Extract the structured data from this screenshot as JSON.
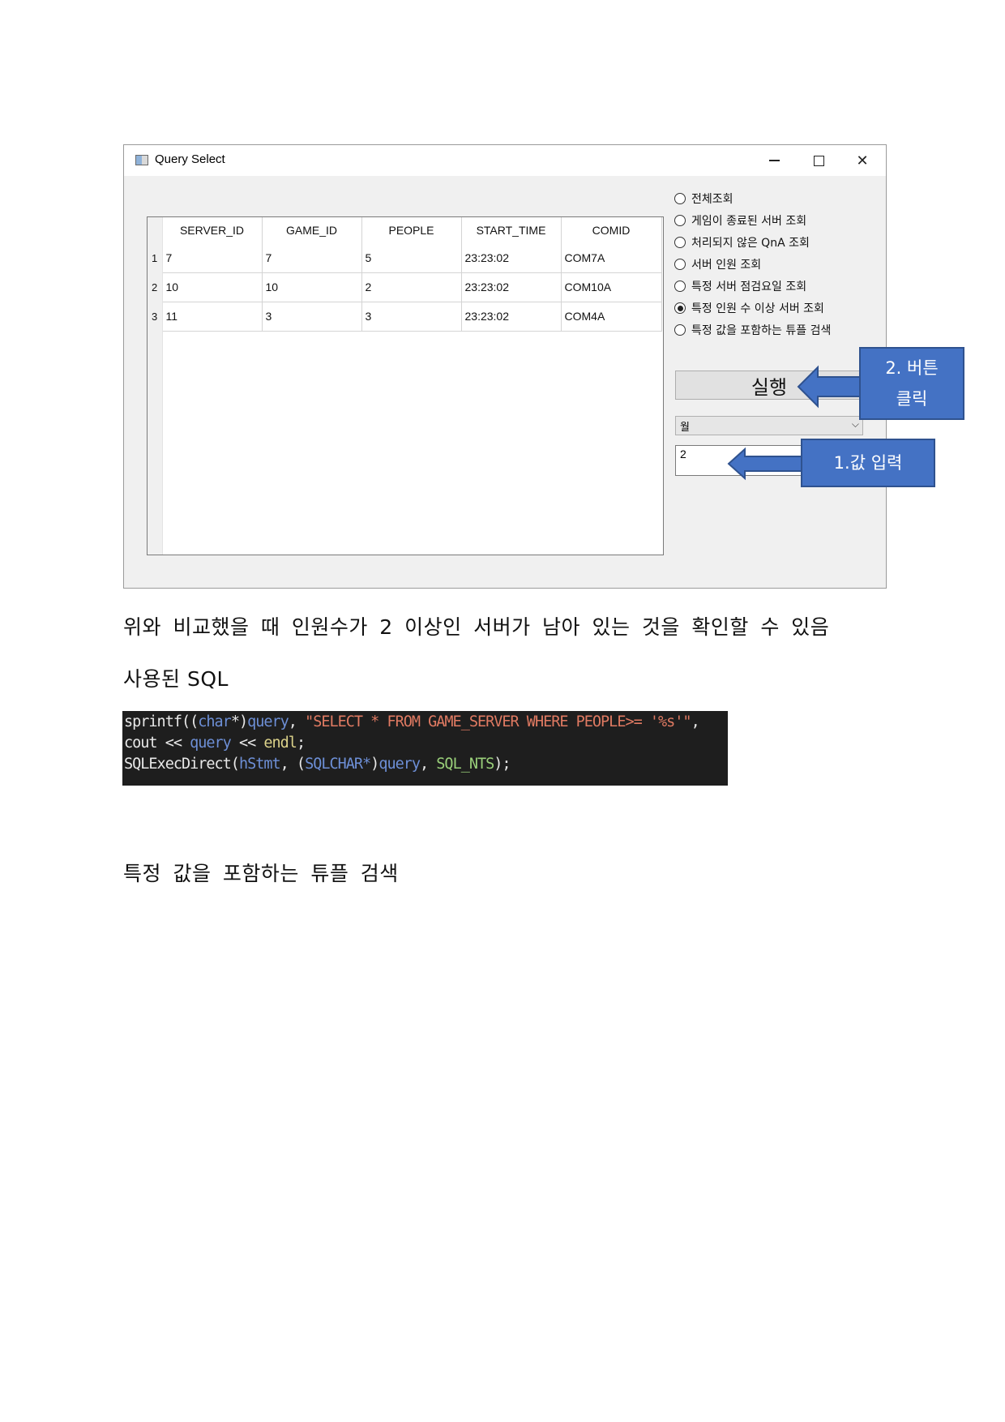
{
  "window": {
    "title": "Query Select",
    "controls": {
      "minimize": "—",
      "close": "✕"
    }
  },
  "table": {
    "columns": [
      "SERVER_ID",
      "GAME_ID",
      "PEOPLE",
      "START_TIME",
      "COMID"
    ],
    "rows": [
      {
        "num": "1",
        "cells": [
          "7",
          "7",
          "5",
          "23:23:02",
          "COM7A"
        ]
      },
      {
        "num": "2",
        "cells": [
          "10",
          "10",
          "2",
          "23:23:02",
          "COM10A"
        ]
      },
      {
        "num": "3",
        "cells": [
          "11",
          "3",
          "3",
          "23:23:02",
          "COM4A"
        ]
      }
    ]
  },
  "options": [
    {
      "label": "전체조회",
      "selected": false
    },
    {
      "label": "게임이 종료된 서버 조회",
      "selected": false
    },
    {
      "label": "처리되지 않은 QnA 조회",
      "selected": false
    },
    {
      "label": "서버 인원 조회",
      "selected": false
    },
    {
      "label": "특정 서버 점검요일 조회",
      "selected": false
    },
    {
      "label": "특정 인원 수 이상 서버 조회",
      "selected": true
    },
    {
      "label": "특정 값을 포함하는 튜플 검색",
      "selected": false
    }
  ],
  "run_button": "실행",
  "combo": {
    "value": "월",
    "arrow": "⌵"
  },
  "value_input": "2",
  "callouts": {
    "click_line1": "2. 버튼",
    "click_line2": "클릭",
    "input": "1.값 입력"
  },
  "colors": {
    "callout_fill": "#4472c4",
    "callout_border": "#2f528f",
    "code_bg": "#1e1e1e"
  },
  "text": {
    "compare": "위와 비교했을 때 인원수가 2 이상인 서버가 남아 있는 것을 확인할 수 있음",
    "sql_heading": "사용된 SQL",
    "next_heading": "특정 값을 포함하는 튜플 검색"
  },
  "code": {
    "l1_a": "sprintf((",
    "l1_b": "char",
    "l1_c": "*)",
    "l1_d": "query",
    "l1_e": ", ",
    "l1_f": "\"SELECT * FROM GAME_SERVER WHERE PEOPLE>= '%s'\"",
    "l1_g": ",",
    "l2_a": "cout ",
    "l2_b": "<< ",
    "l2_c": "query",
    "l2_d": " << ",
    "l2_e": "endl",
    "l2_f": ";",
    "l3_a": "SQLExecDirect(",
    "l3_b": "hStmt",
    "l3_c": ", (",
    "l3_d": "SQLCHAR*",
    "l3_e": ")",
    "l3_f": "query",
    "l3_g": ", ",
    "l3_h": "SQL_NTS",
    "l3_i": ");"
  }
}
